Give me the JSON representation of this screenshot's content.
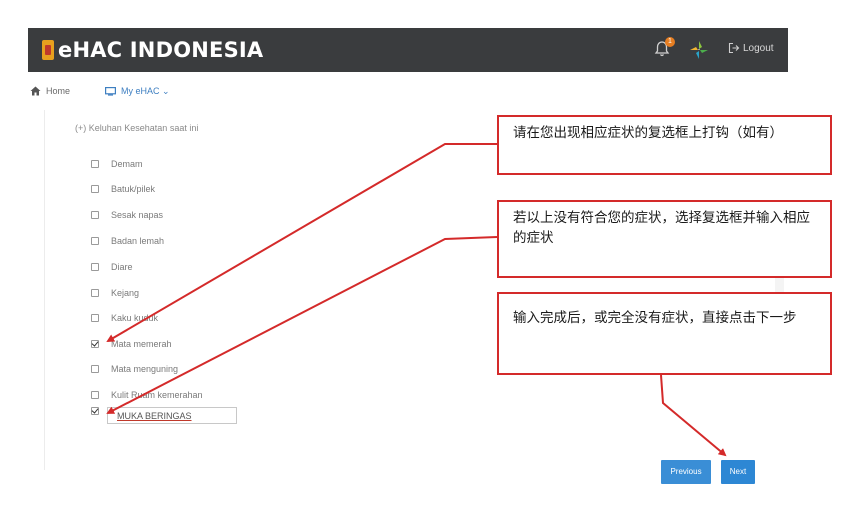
{
  "header": {
    "brand": "eHAC INDONESIA",
    "notification_count": "1",
    "logout_label": "Logout"
  },
  "nav": {
    "home_label": "Home",
    "my_ehac_label": "My eHAC ⌄"
  },
  "form": {
    "section_label": "(+) Keluhan Kesehatan saat ini",
    "symptoms": [
      {
        "label": "Demam",
        "checked": false
      },
      {
        "label": "Batuk/pilek",
        "checked": false
      },
      {
        "label": "Sesak napas",
        "checked": false
      },
      {
        "label": "Badan lemah",
        "checked": false
      },
      {
        "label": "Diare",
        "checked": false
      },
      {
        "label": "Kejang",
        "checked": false
      },
      {
        "label": "Kaku kuduk",
        "checked": false
      },
      {
        "label": "Mata memerah",
        "checked": true
      },
      {
        "label": "Mata menguning",
        "checked": false
      },
      {
        "label": "Kulit Ruam kemerahan",
        "checked": false
      }
    ],
    "other_checked": true,
    "other_value": "MUKA BERINGAS",
    "previous_label": "Previous",
    "next_label": "Next"
  },
  "annotations": {
    "callout_1": "请在您出现相应症状的复选框上打钩（如有）",
    "callout_2": "若以上没有符合您的症状，选择复选框并输入相应的症状",
    "callout_3": "输入完成后，或完全没有症状，直接点击下一步"
  },
  "colors": {
    "header_bg": "#3a3c3e",
    "accent_blue": "#2d87d4",
    "annotation_red": "#d42a2a"
  }
}
